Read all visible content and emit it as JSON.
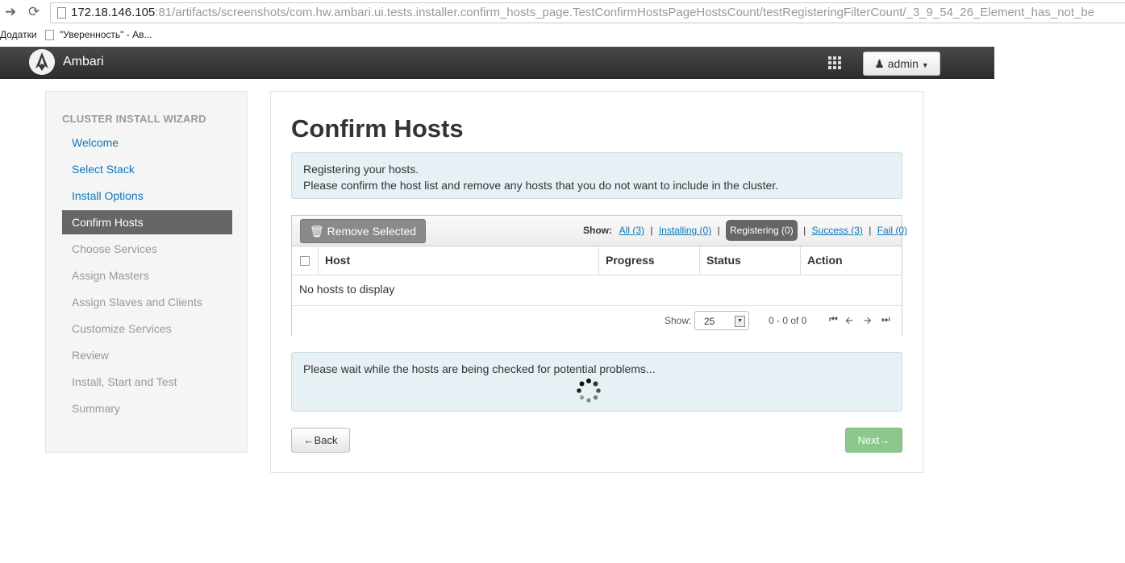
{
  "browser": {
    "url_host": "172.18.146.105",
    "url_rest": ":81/artifacts/screenshots/com.hw.ambari.ui.tests.installer.confirm_hosts_page.TestConfirmHostsPageHostsCount/testRegisteringFilterCount/_3_9_54_26_Element_has_not_be",
    "bookmarks": [
      "Додатки",
      "\"Уверенность\" - Ав..."
    ]
  },
  "navbar": {
    "brand": "Ambari",
    "user_menu": "admin"
  },
  "sidebar": {
    "title": "CLUSTER INSTALL WIZARD",
    "items": [
      {
        "label": "Welcome",
        "state": "link"
      },
      {
        "label": "Select Stack",
        "state": "link"
      },
      {
        "label": "Install Options",
        "state": "link"
      },
      {
        "label": "Confirm Hosts",
        "state": "active"
      },
      {
        "label": "Choose Services",
        "state": "disabled"
      },
      {
        "label": "Assign Masters",
        "state": "disabled"
      },
      {
        "label": "Assign Slaves and Clients",
        "state": "disabled"
      },
      {
        "label": "Customize Services",
        "state": "disabled"
      },
      {
        "label": "Review",
        "state": "disabled"
      },
      {
        "label": "Install, Start and Test",
        "state": "disabled"
      },
      {
        "label": "Summary",
        "state": "disabled"
      }
    ]
  },
  "main": {
    "title": "Confirm Hosts",
    "info_line1": "Registering your hosts.",
    "info_line2": "Please confirm the host list and remove any hosts that you do not want to include in the cluster.",
    "remove_button": "Remove Selected",
    "show_label": "Show:",
    "filters": [
      {
        "label": "All (3)",
        "active": false
      },
      {
        "label": "Installing (0)",
        "active": false
      },
      {
        "label": "Registering (0)",
        "active": true
      },
      {
        "label": "Success (3)",
        "active": false
      },
      {
        "label": "Fail (0)",
        "active": false
      }
    ],
    "columns": [
      "Host",
      "Progress",
      "Status",
      "Action"
    ],
    "empty_text": "No hosts to display",
    "pager": {
      "show_label": "Show:",
      "page_size": "25",
      "count_text": "0 - 0 of 0"
    },
    "wait_text": "Please wait while the hosts are being checked for potential problems...",
    "back_button": "←Back",
    "next_button": "Next→"
  },
  "colors": {
    "link": "#0a79b8",
    "active_nav": "#666666",
    "next_button": "#8cc88c",
    "alert_bg": "#e6f0f5"
  }
}
